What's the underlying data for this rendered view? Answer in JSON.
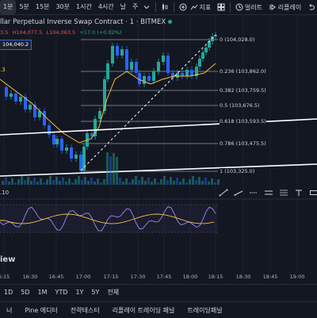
{
  "toolbar": {
    "timeframes": [
      {
        "label": "1분",
        "active": true
      },
      {
        "label": "5분",
        "active": false
      },
      {
        "label": "15분",
        "active": false
      },
      {
        "label": "30분",
        "active": false
      },
      {
        "label": "1시간",
        "active": false
      },
      {
        "label": "4시간",
        "active": false
      },
      {
        "label": "날",
        "active": false
      },
      {
        "label": "주",
        "active": false
      }
    ],
    "indicators_label": "지표",
    "alert_label": "얼러트",
    "replay_label": "리플레이"
  },
  "chart": {
    "title": "llar Perpetual Inverse Swap Contract · 1 · BITMEX",
    "ohlc": {
      "o": "3.5",
      "h": "H104,077.5",
      "l": "L104,063.5",
      "c": "+17.0 (+0.02%)"
    },
    "price_box": "104,040.2",
    "ma_value": ".3",
    "volume_value": ".10",
    "fib_levels": [
      {
        "level": "0 (104,028.0)"
      },
      {
        "level": "0.236 (103,862.0)"
      },
      {
        "level": "0.382 (103,759.5)"
      },
      {
        "level": "0.5 (103,676.5)"
      },
      {
        "level": "0.618 (103,593.5)"
      },
      {
        "level": "0.786 (103,475.5)"
      },
      {
        "level": "1 (103,325.0)"
      }
    ],
    "panel_title": "iew",
    "time_ticks": [
      "6:15",
      "16:30",
      "16:45",
      "17:00",
      "17:15",
      "17:30",
      "17:45",
      "18:00",
      "18:15",
      "18:30",
      "18:45",
      "19:00"
    ],
    "colors": {
      "up": "#26a69a",
      "down": "#2962ff",
      "ma": "#f0c040",
      "rsi": "#9c8ce8",
      "fib": "#d1d4dc"
    }
  },
  "range_bar": [
    "1D",
    "5D",
    "1M",
    "YTD",
    "1Y",
    "5Y",
    "전체"
  ],
  "bottom_tabs": [
    "너",
    "Pine 에디터",
    "전략테스터",
    "리플레이 트레이딩 패널",
    "트레이딩패널"
  ]
}
